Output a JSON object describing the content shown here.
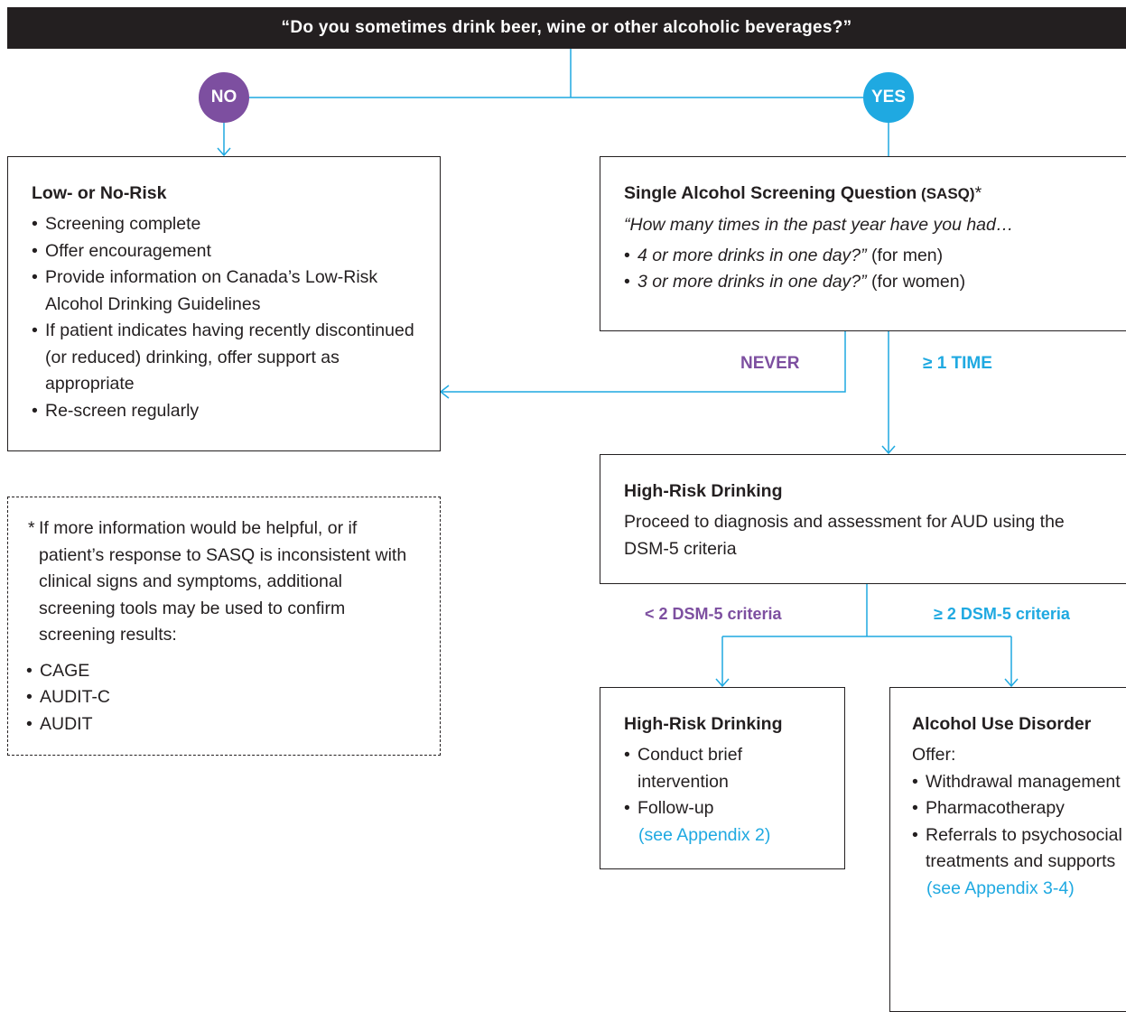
{
  "question": "“Do you sometimes drink beer, wine or other alcoholic beverages?”",
  "no_label": "NO",
  "yes_label": "YES",
  "low_risk": {
    "title": "Low- or No-Risk",
    "items": [
      "Screening complete",
      "Offer encouragement",
      "Provide information on Canada’s Low-Risk Alcohol Drinking Guidelines",
      "If patient indicates having recently discontinued (or reduced) drinking, offer support as appropriate",
      "Re-screen regularly"
    ]
  },
  "sasq": {
    "title": "Single Alcohol Screening Question",
    "title_abbr": " (SASQ)",
    "title_star": "*",
    "question": "“How many times in the past year have you had…",
    "items": [
      {
        "q": "4 or more drinks in one day?”",
        "who": " (for men)"
      },
      {
        "q": "3 or more drinks in one day?”",
        "who": " (for women)"
      }
    ]
  },
  "never_label": "NEVER",
  "once_label": "≥ 1 TIME",
  "high_risk": {
    "title": "High-Risk Drinking",
    "text": "Proceed to diagnosis and assessment for AUD using the DSM-5 criteria"
  },
  "lt2_label": "< 2 DSM-5 criteria",
  "ge2_label": "≥ 2 DSM-5 criteria",
  "hrd2": {
    "title": "High-Risk Drinking",
    "items": [
      "Conduct brief intervention",
      "Follow-up"
    ],
    "link": "(see Appendix 2)"
  },
  "aud": {
    "title": "Alcohol Use Disorder",
    "offer": "Offer:",
    "items": [
      "Withdrawal management",
      "Pharmacotherapy",
      "Referrals to psychosocial treatments and supports"
    ],
    "link": "(see Appendix 3-4)"
  },
  "note": {
    "star": "*",
    "text": "If more information would be helpful, or if patient’s response to SASQ is inconsistent with clinical signs and symptoms, additional screening tools may be used to confirm screening results:",
    "items": [
      "CAGE",
      "AUDIT-C",
      "AUDIT"
    ]
  },
  "colors": {
    "purple": "#7d4fa0",
    "blue": "#1fa9e1",
    "dark": "#231f20"
  }
}
